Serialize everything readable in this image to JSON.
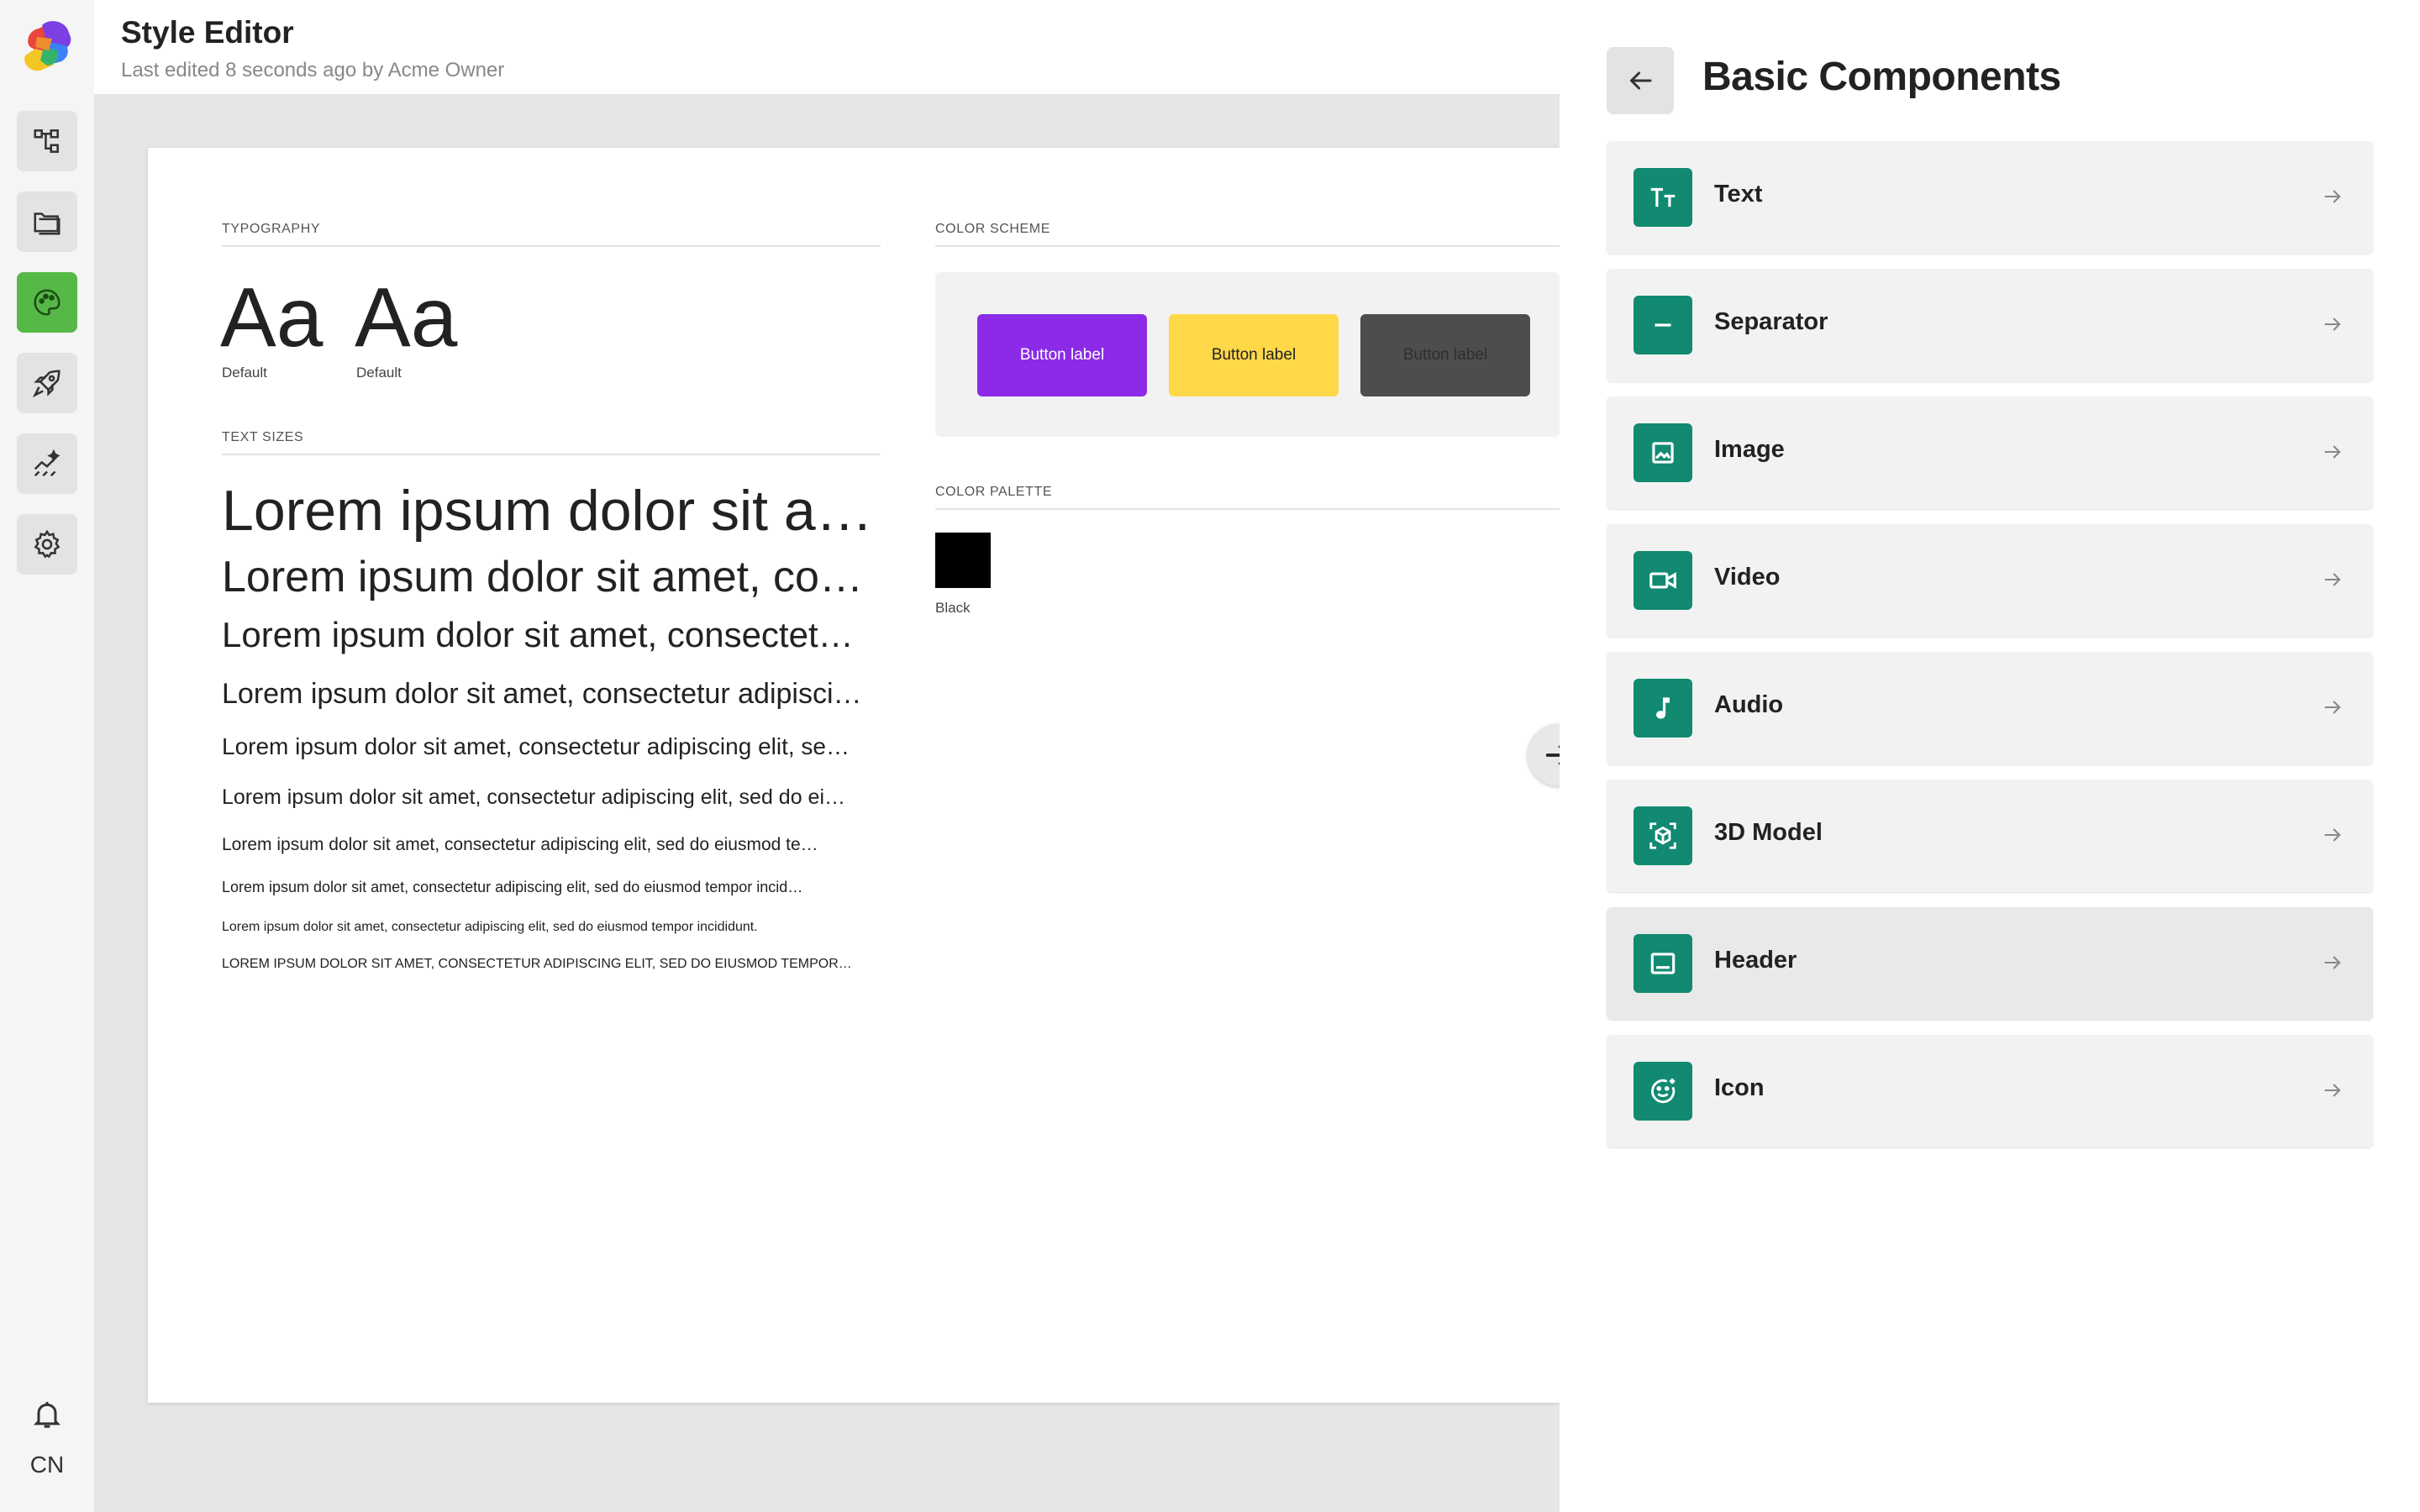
{
  "app": {
    "title": "Style Editor",
    "subtitle": "Last edited 8 seconds ago by Acme Owner",
    "user_initials": "CN"
  },
  "rail": {
    "items": [
      {
        "name": "structure-icon",
        "active": false
      },
      {
        "name": "folder-icon",
        "active": false
      },
      {
        "name": "palette-icon",
        "active": true
      },
      {
        "name": "rocket-icon",
        "active": false
      },
      {
        "name": "analytics-icon",
        "active": false
      },
      {
        "name": "settings-icon",
        "active": false
      }
    ]
  },
  "canvas": {
    "typography": {
      "label": "TYPOGRAPHY",
      "samples": [
        {
          "glyph": "Aa",
          "caption": "Default"
        },
        {
          "glyph": "Aa",
          "caption": "Default"
        }
      ]
    },
    "text_sizes": {
      "label": "TEXT SIZES",
      "lines": [
        "Lorem ipsum dolor sit a…",
        "Lorem ipsum dolor sit amet, co…",
        "Lorem ipsum dolor sit amet, consectet…",
        "Lorem ipsum dolor sit amet, consectetur adipisci…",
        "Lorem ipsum dolor sit amet, consectetur adipiscing elit, se…",
        "Lorem ipsum dolor sit amet, consectetur adipiscing elit, sed do ei…",
        "Lorem ipsum dolor sit amet, consectetur adipiscing elit, sed do eiusmod te…",
        "Lorem ipsum dolor sit amet, consectetur adipiscing elit, sed do eiusmod tempor incid…",
        "Lorem ipsum dolor sit amet, consectetur adipiscing elit, sed do eiusmod tempor incididunt.",
        "LOREM IPSUM DOLOR SIT AMET, CONSECTETUR ADIPISCING ELIT, SED DO EIUSMOD TEMPOR…"
      ]
    },
    "color_scheme": {
      "label": "COLOR SCHEME",
      "buttons": [
        {
          "label": "Button label",
          "bg": "#8b2be8",
          "fg": "#ffffff"
        },
        {
          "label": "Button label",
          "bg": "#ffd84a",
          "fg": "#222222"
        },
        {
          "label": "Button label",
          "bg": "#4d4d4b",
          "fg": "#2e2e2e"
        }
      ]
    },
    "color_palette": {
      "label": "COLOR PALETTE",
      "swatches": [
        {
          "name": "Black",
          "color": "#000000"
        }
      ]
    }
  },
  "panel": {
    "title": "Basic Components",
    "accent": "#118a71",
    "components": [
      {
        "label": "Text",
        "icon": "text-size-icon"
      },
      {
        "label": "Separator",
        "icon": "separator-icon"
      },
      {
        "label": "Image",
        "icon": "image-icon"
      },
      {
        "label": "Video",
        "icon": "video-icon"
      },
      {
        "label": "Audio",
        "icon": "music-note-icon"
      },
      {
        "label": "3D Model",
        "icon": "cube-icon"
      },
      {
        "label": "Header",
        "icon": "header-icon"
      },
      {
        "label": "Icon",
        "icon": "smiley-icon"
      }
    ]
  }
}
